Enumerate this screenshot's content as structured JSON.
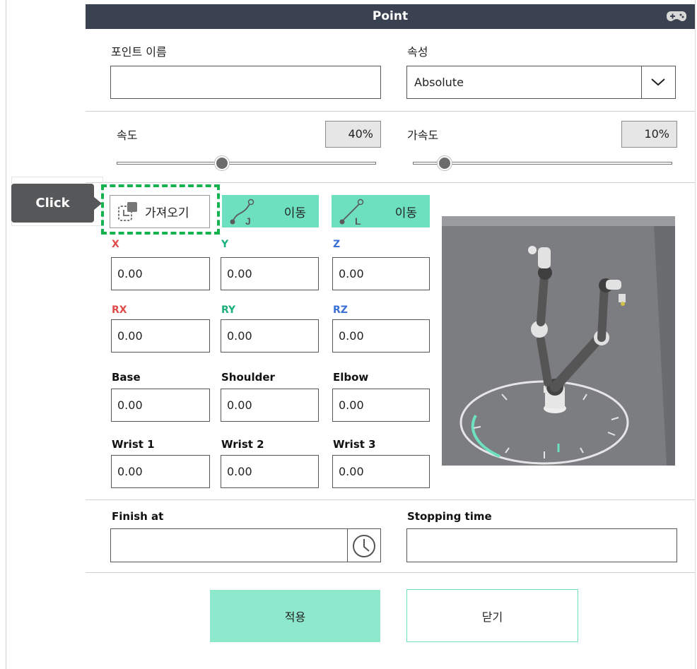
{
  "window": {
    "title": "Point",
    "gamepad_icon": "gamepad-icon"
  },
  "point_name": {
    "label": "포인트 이름",
    "value": ""
  },
  "attribute": {
    "label": "속성",
    "selected": "Absolute",
    "dropdown_icon": "chevron-down-icon"
  },
  "speed": {
    "label": "속도",
    "value_text": "40%",
    "value": 0.4
  },
  "acceleration": {
    "label": "가속도",
    "value_text": "10%",
    "value": 0.1
  },
  "toolbar": {
    "fetch_label": "가져오기",
    "move_j_label": "이동",
    "move_l_label": "이동",
    "move_j_letter": "J",
    "move_l_letter": "L"
  },
  "callout": {
    "text": "Click"
  },
  "fields": {
    "x": {
      "label": "X",
      "value": "0.00",
      "color": "#e04b4b"
    },
    "y": {
      "label": "Y",
      "value": "0.00",
      "color": "#1bb07a"
    },
    "z": {
      "label": "Z",
      "value": "0.00",
      "color": "#3a6fd6"
    },
    "rx": {
      "label": "RX",
      "value": "0.00",
      "color": "#e04b4b"
    },
    "ry": {
      "label": "RY",
      "value": "0.00",
      "color": "#1bb07a"
    },
    "rz": {
      "label": "RZ",
      "value": "0.00",
      "color": "#3a6fd6"
    },
    "base": {
      "label": "Base",
      "value": "0.00"
    },
    "shoulder": {
      "label": "Shoulder",
      "value": "0.00"
    },
    "elbow": {
      "label": "Elbow",
      "value": "0.00"
    },
    "wrist1": {
      "label": "Wrist 1",
      "value": "0.00"
    },
    "wrist2": {
      "label": "Wrist 2",
      "value": "0.00"
    },
    "wrist3": {
      "label": "Wrist 3",
      "value": "0.00"
    }
  },
  "finish_at": {
    "label": "Finish at",
    "value": "",
    "icon": "clock-icon"
  },
  "stopping_time": {
    "label": "Stopping time",
    "value": ""
  },
  "buttons": {
    "apply": "적용",
    "close": "닫기"
  },
  "colors": {
    "accent": "#6de0bf",
    "apply_bg": "#8ee8cc",
    "titlebar": "#3a4150",
    "highlight": "#14b34f"
  }
}
